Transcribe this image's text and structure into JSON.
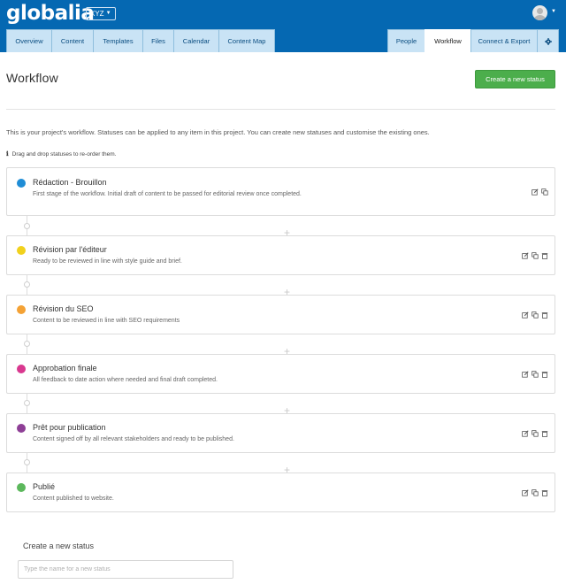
{
  "header": {
    "logo": "globalia",
    "project_selector": "XYZ",
    "colors": {
      "brand": "#0568b2",
      "tab_bg": "#c9e3f5"
    }
  },
  "nav": {
    "tabs_left": [
      {
        "label": "Overview"
      },
      {
        "label": "Content"
      },
      {
        "label": "Templates"
      },
      {
        "label": "Files"
      },
      {
        "label": "Calendar"
      },
      {
        "label": "Content Map"
      }
    ],
    "tabs_right": [
      {
        "label": "People"
      },
      {
        "label": "Workflow",
        "active": true
      },
      {
        "label": "Connect & Export"
      },
      {
        "label": "",
        "icon": "gear-icon"
      }
    ]
  },
  "page": {
    "title": "Workflow",
    "create_button": "Create a new status",
    "intro": "This is your project's workflow. Statuses can be applied to any item in this project. You can create new statuses and customise the existing ones.",
    "hint": "Drag and drop statuses to re-order them.",
    "hint_icon": "info-icon"
  },
  "statuses": [
    {
      "name": "Rédaction - Brouillon",
      "color": "#1f8dd6",
      "description": "First stage of the workflow. Initial draft of content to be passed for editorial review once completed.",
      "deletable": false
    },
    {
      "name": "Révision par l'éditeur",
      "color": "#f1d11d",
      "description": "Ready to be reviewed in line with style guide and brief.",
      "deletable": true
    },
    {
      "name": "Révision du SEO",
      "color": "#f4a235",
      "description": "Content to be reviewed in line with SEO requirements",
      "deletable": true
    },
    {
      "name": "Approbation finale",
      "color": "#d9388f",
      "description": "All feedback to date action where needed and final draft completed.",
      "deletable": true
    },
    {
      "name": "Prêt pour publication",
      "color": "#8e3f96",
      "description": "Content signed off by all relevant stakeholders and ready to be published.",
      "deletable": true
    },
    {
      "name": "Publié",
      "color": "#5cb85c",
      "description": "Content published to website.",
      "deletable": true
    }
  ],
  "new_status": {
    "label": "Create a new status",
    "placeholder": "Type the name for a new status",
    "value": ""
  }
}
